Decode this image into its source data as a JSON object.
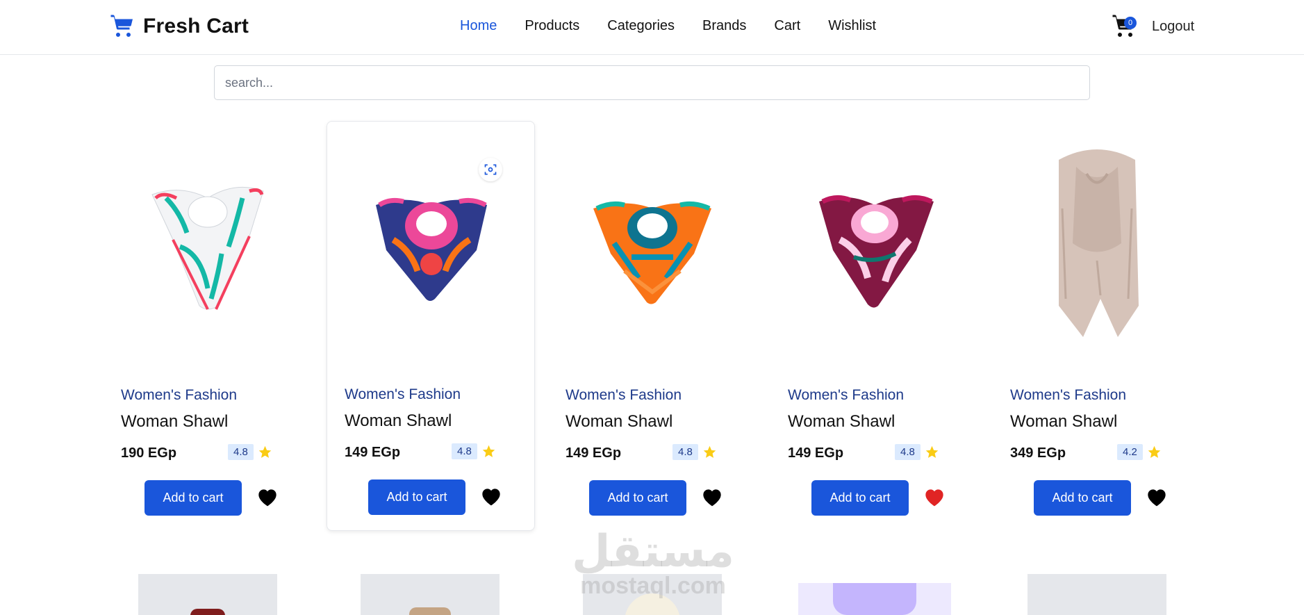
{
  "brand": {
    "name": "Fresh Cart",
    "icon": "shopping-cart-icon",
    "color": "#1a56db"
  },
  "nav": {
    "links": [
      {
        "label": "Home",
        "active": true
      },
      {
        "label": "Products",
        "active": false
      },
      {
        "label": "Categories",
        "active": false
      },
      {
        "label": "Brands",
        "active": false
      },
      {
        "label": "Cart",
        "active": false
      },
      {
        "label": "Wishlist",
        "active": false
      }
    ],
    "cart_count": "0",
    "logout_label": "Logout"
  },
  "search": {
    "placeholder": "search...",
    "value": ""
  },
  "products": [
    {
      "category": "Women's Fashion",
      "title": "Woman Shawl",
      "price": "190 EGp",
      "rating": "4.8",
      "button": "Add to cart",
      "wishlisted": false,
      "image": "white-teal-floral-scarf"
    },
    {
      "category": "Women's Fashion",
      "title": "Woman Shawl",
      "price": "149 EGp",
      "rating": "4.8",
      "button": "Add to cart",
      "wishlisted": false,
      "image": "pink-navy-floral-scarf"
    },
    {
      "category": "Women's Fashion",
      "title": "Woman Shawl",
      "price": "149 EGp",
      "rating": "4.8",
      "button": "Add to cart",
      "wishlisted": false,
      "image": "orange-teal-geometric-scarf"
    },
    {
      "category": "Women's Fashion",
      "title": "Woman Shawl",
      "price": "149 EGp",
      "rating": "4.8",
      "button": "Add to cart",
      "wishlisted": true,
      "image": "burgundy-floral-scarf"
    },
    {
      "category": "Women's Fashion",
      "title": "Woman Shawl",
      "price": "349 EGp",
      "rating": "4.2",
      "button": "Add to cart",
      "wishlisted": false,
      "image": "beige-long-shawl"
    }
  ],
  "watermark": {
    "arabic": "مستقل",
    "latin": "mostaql.com"
  },
  "colors": {
    "accent": "#1a56db",
    "category": "#1e3a8a",
    "rating_bg": "#dbeafe",
    "star": "#facc15",
    "heart_active": "#e02424",
    "heart_default": "#000000"
  }
}
